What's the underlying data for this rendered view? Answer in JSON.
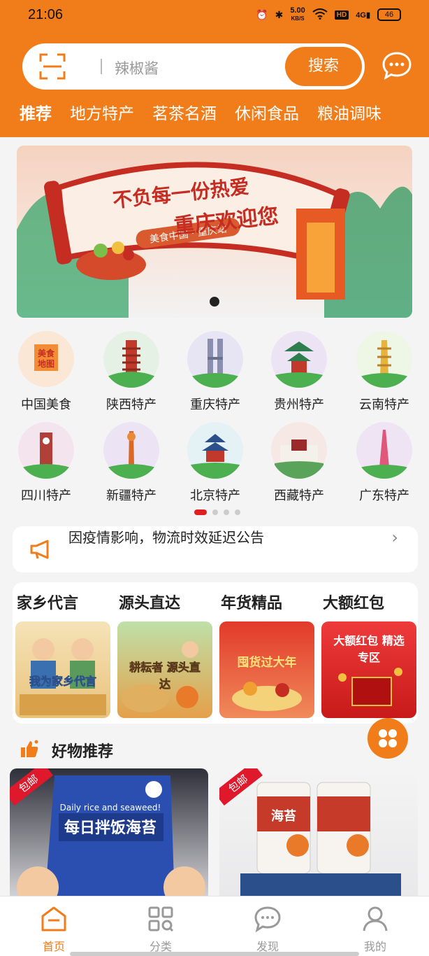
{
  "status_bar": {
    "time": "21:06",
    "network_speed": "5.00",
    "network_speed_unit": "KB/S",
    "hd": "HD",
    "signal": "4G",
    "battery": "46"
  },
  "search": {
    "placeholder": "辣椒酱",
    "button_label": "搜索"
  },
  "category_tabs": [
    "推荐",
    "地方特产",
    "茗茶名酒",
    "休闲食品",
    "粮油调味"
  ],
  "banner": {
    "title_line1": "不负每一份热爱",
    "title_line2": "重庆欢迎您",
    "subtitle": "美食中国 · 重庆站"
  },
  "regions": [
    "中国美食",
    "陕西特产",
    "重庆特产",
    "贵州特产",
    "云南特产",
    "四川特产",
    "新疆特产",
    "北京特产",
    "西藏特产",
    "广东特产"
  ],
  "region_badge": {
    "line1": "美食",
    "line2": "地图"
  },
  "notice": {
    "text": "因疫情影响，物流时效延迟公告"
  },
  "promo": [
    {
      "title": "家乡代言",
      "caption": "我为家乡代言"
    },
    {
      "title": "源头直达",
      "caption": "耕耘者 源头直达"
    },
    {
      "title": "年货精品",
      "caption": "囤货过大年"
    },
    {
      "title": "大额红包",
      "caption": "大额红包 精选专区"
    }
  ],
  "good_things": {
    "title": "好物推荐",
    "ribbon": "包邮"
  },
  "products": [
    {
      "line1": "Daily rice and seaweed!",
      "line2": "每日拌饭海苔"
    },
    {
      "line1": "海苔"
    }
  ],
  "bottom_nav": [
    "首页",
    "分类",
    "发现",
    "我的"
  ],
  "colors": {
    "brand": "#f07c1a",
    "ribbon": "#e0182b",
    "background": "#f4f4f4"
  }
}
